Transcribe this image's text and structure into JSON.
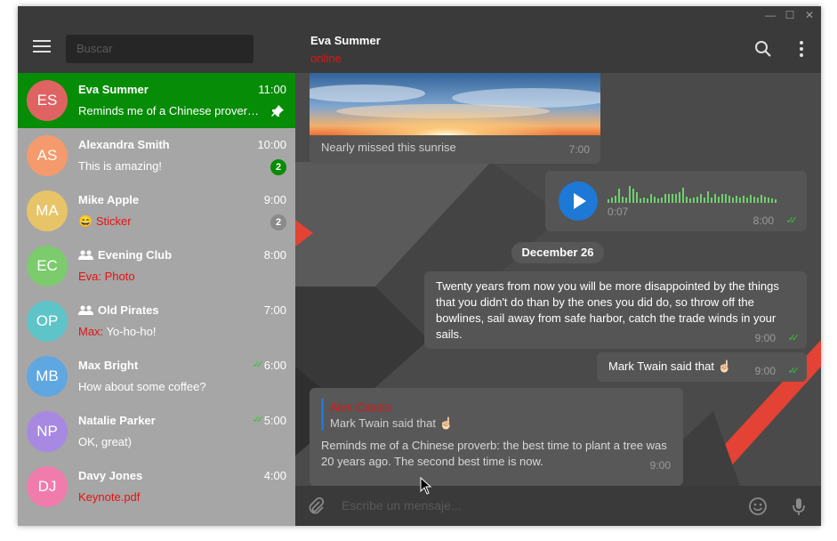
{
  "window": {
    "controls": [
      "minimize-icon",
      "maximize-icon",
      "close-icon"
    ]
  },
  "sidebar": {
    "search_placeholder": "Buscar",
    "chats": [
      {
        "initials": "ES",
        "name": "Eva Summer",
        "time": "11:00",
        "message": "Reminds me of a Chinese prover…",
        "avatar_color": "#e06363",
        "active": true,
        "pinned": true
      },
      {
        "initials": "AS",
        "name": "Alexandra Smith",
        "time": "10:00",
        "message": "This is amazing!",
        "avatar_color": "#f59a6c",
        "badge": "2",
        "badge_color": "#068c06"
      },
      {
        "initials": "MA",
        "name": "Mike Apple",
        "time": "9:00",
        "sender_prefix": "😄",
        "message": "Sticker",
        "message_highlight": true,
        "avatar_color": "#e8c468",
        "badge": "2",
        "badge_color": "#8a8a8a"
      },
      {
        "initials": "EC",
        "name": "Evening Club",
        "time": "8:00",
        "sender_prefix": "Eva:",
        "message": "Photo",
        "message_highlight": true,
        "group": true,
        "avatar_color": "#7ccb6c"
      },
      {
        "initials": "OP",
        "name": "Old Pirates",
        "time": "7:00",
        "sender_prefix": "Max:",
        "message": "Yo-ho-ho!",
        "group": true,
        "avatar_color": "#5ec4c8"
      },
      {
        "initials": "MB",
        "name": "Max Bright",
        "time": "6:00",
        "message": "How about some coffee?",
        "read": true,
        "avatar_color": "#5fa7e0"
      },
      {
        "initials": "NP",
        "name": "Natalie Parker",
        "time": "5:00",
        "message": "OK, great)",
        "read": true,
        "avatar_color": "#a789e2"
      },
      {
        "initials": "DJ",
        "name": "Davy Jones",
        "time": "4:00",
        "message": "Keynote.pdf",
        "message_highlight": true,
        "avatar_color": "#f07cac"
      }
    ]
  },
  "header": {
    "name": "Eva Summer",
    "status": "online"
  },
  "messages": {
    "photo_caption": "Nearly missed this sunrise",
    "photo_time": "7:00",
    "voice_duration": "0:07",
    "voice_time": "8:00",
    "date_separator": "December 26",
    "quote_text": "Twenty years from now you will be more disappointed by the things that you didn't do than by the ones you did do, so throw off the bowlines, sail away from safe harbor, catch the trade winds in your sails.",
    "quote_time": "9:00",
    "short_text": "Mark Twain said that ☝🏻",
    "short_time": "9:00",
    "reply_author": "Alex Cassio",
    "reply_quoted": "Mark Twain said that ☝🏻",
    "reply_text": "Reminds me of a Chinese proverb: the best time to plant a tree was 20 years ago. The second best time is now.",
    "reply_time": "9:00"
  },
  "composer": {
    "placeholder": "Escribe un mensaje..."
  },
  "colors": {
    "accent": "#068c06",
    "highlight": "#e81212",
    "read_ticks": "#38c238",
    "play_button": "#1e78d6"
  }
}
